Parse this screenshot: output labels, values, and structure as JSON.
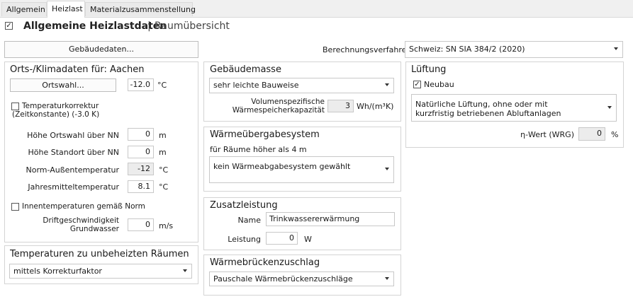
{
  "tabs": [
    "Allgemein",
    "Heizlast",
    "Materialzusammenstellung"
  ],
  "active_tab": "Heizlast",
  "header": {
    "checked": true,
    "title": "Allgemeine Heizlastdaten",
    "separator": "|",
    "subtitle": "Raumübersicht"
  },
  "buttons": {
    "gebaeudedaten": "Gebäudedaten...",
    "ortswahl": "Ortswahl..."
  },
  "berechnung": {
    "label": "Berechnungsverfahren",
    "value": "Schweiz: SN SIA 384/2 (2020)"
  },
  "klima": {
    "title": "Orts-/Klimadaten für: Aachen",
    "ortswahl_value": "-12.0",
    "ortswahl_unit": "°C",
    "temp_korrektur_checked": false,
    "temp_korrektur_label_1": "Temperaturkorrektur",
    "temp_korrektur_label_2": "(Zeitkonstante) (-3.0 K)",
    "hoehe_ortswahl_label": "Höhe Ortswahl über NN",
    "hoehe_ortswahl_value": "0",
    "hoehe_ortswahl_unit": "m",
    "hoehe_standort_label": "Höhe Standort über NN",
    "hoehe_standort_value": "0",
    "hoehe_standort_unit": "m",
    "norm_aussen_label": "Norm-Außentemperatur",
    "norm_aussen_value": "-12",
    "norm_aussen_unit": "°C",
    "jahresmittel_label": "Jahresmitteltemperatur",
    "jahresmittel_value": "8.1",
    "jahresmittel_unit": "°C",
    "innentemp_checked": false,
    "innentemp_label": "Innentemperaturen gemäß Norm",
    "drift_label_1": "Driftgeschwindigkeit",
    "drift_label_2": "Grundwasser",
    "drift_value": "0",
    "drift_unit": "m/s"
  },
  "unbeheizt": {
    "title": "Temperaturen zu unbeheizten Räumen",
    "value": "mittels Korrekturfaktor"
  },
  "gebaeudemasse": {
    "title": "Gebäudemasse",
    "value": "sehr leichte Bauweise",
    "kapazitaet_label_1": "Volumenspezifische",
    "kapazitaet_label_2": "Wärmespeicherkapazität",
    "kapazitaet_value": "3",
    "kapazitaet_unit": "Wh/(m³K)"
  },
  "waermeuebergabe": {
    "title": "Wärmeübergabesystem",
    "subtitle": "für Räume höher als 4 m",
    "value": "kein Wärmeabgabesystem gewählt"
  },
  "zusatzleistung": {
    "title": "Zusatzleistung",
    "name_label": "Name",
    "name_value": "Trinkwassererwärmung",
    "leistung_label": "Leistung",
    "leistung_value": "0",
    "leistung_unit": "W"
  },
  "waermebruecken": {
    "title": "Wärmebrückenzuschlag",
    "value": "Pauschale Wärmebrückenzuschläge"
  },
  "lueftung": {
    "title": "Lüftung",
    "neubau_checked": true,
    "neubau_label": "Neubau",
    "value_1": "Natürliche Lüftung, ohne oder mit",
    "value_2": "kurzfristig betriebenen Abluftanlagen",
    "eta_label": "η-Wert (WRG)",
    "eta_value": "0",
    "eta_unit": "%"
  }
}
